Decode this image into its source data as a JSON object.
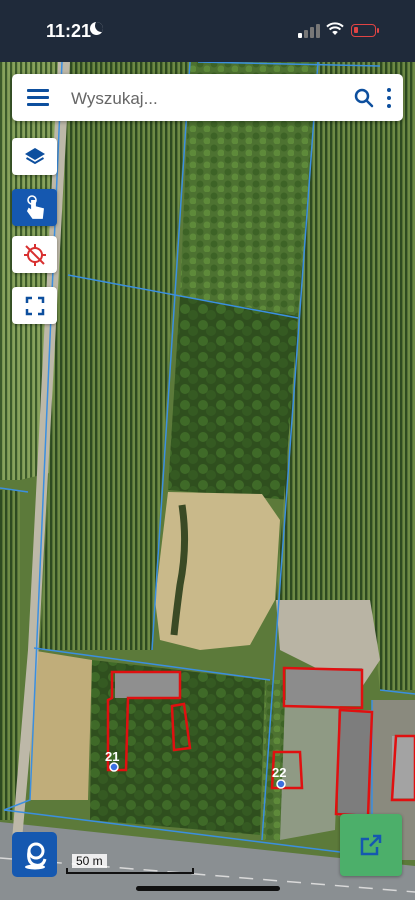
{
  "status_bar": {
    "time": "11:21"
  },
  "search": {
    "placeholder": "Wyszukaj..."
  },
  "map": {
    "plots": [
      {
        "label": "21"
      },
      {
        "label": "22"
      }
    ],
    "scale_label": "50 m"
  },
  "colors": {
    "brand_blue": "#1558b0",
    "parcel_border": "#3b8fe0",
    "building_outline": "#e01010",
    "open_button": "#4caf6a"
  },
  "icons": [
    "menu-icon",
    "search-icon",
    "more-icon",
    "layers-icon",
    "touch-icon",
    "location-off-icon",
    "fullscreen-icon",
    "geoportal-logo-icon",
    "open-external-icon"
  ]
}
